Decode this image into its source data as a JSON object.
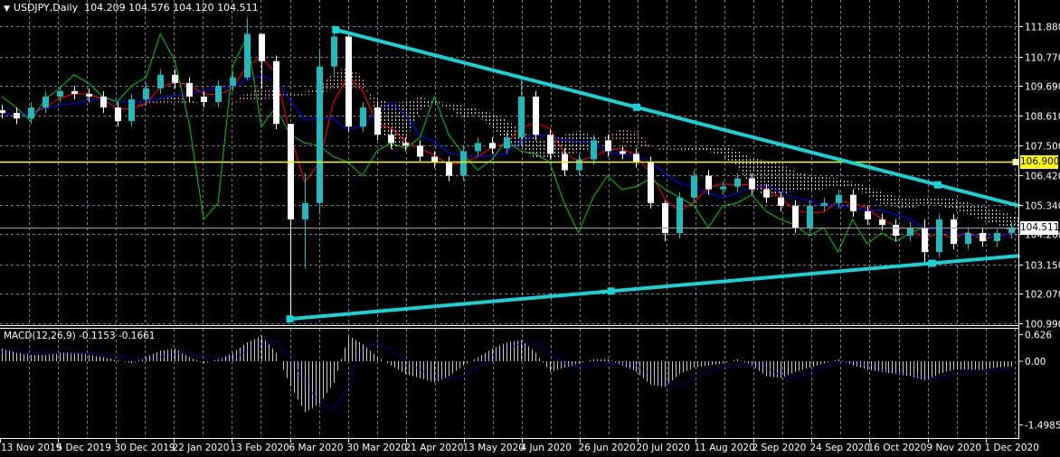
{
  "header": {
    "symbol_timeframe": "USDJPY,Daily",
    "ohlc": "104.209 104.576 104.120 104.511",
    "menu_icon": "triangle-down-icon"
  },
  "macd_header": {
    "label": "MACD(12,26,9)",
    "values": "-0.1153 -0.1661"
  },
  "colors": {
    "background": "#000000",
    "bull_candle": "#26b8b8",
    "bear_candle": "#ffffff",
    "trendline": "#17d3d3",
    "level_line": "#ffff00",
    "tenkan": "#ff0000",
    "kijun": "#0000ff",
    "chikou": "#00c800",
    "cloud_up": "#f4a460",
    "cloud_down": "#e8e8e8",
    "macd_hist": "#c8c8c8",
    "macd_signal": "#0000ff",
    "grid": "#7a8090"
  },
  "chart_data": [
    {
      "type": "candlestick",
      "symbol": "USDJPY",
      "timeframe": "Daily",
      "price_ticks": [
        "111.880",
        "110.770",
        "109.690",
        "108.610",
        "107.500",
        "106.420",
        "105.340",
        "104.260",
        "103.150",
        "102.070",
        "100.990"
      ],
      "ylim": [
        100.99,
        111.88
      ],
      "date_ticks": [
        "13 Nov 2019",
        "5 Dec 2019",
        "30 Dec 2019",
        "22 Jan 2020",
        "13 Feb 2020",
        "6 Mar 2020",
        "30 Mar 2020",
        "21 Apr 2020",
        "13 May 2020",
        "4 Jun 2020",
        "26 Jun 2020",
        "20 Jul 2020",
        "11 Aug 2020",
        "2 Sep 2020",
        "24 Sep 2020",
        "16 Oct 2020",
        "9 Nov 2020",
        "1 Dec 2020"
      ],
      "grid": true,
      "close": [
        108.7,
        108.5,
        108.9,
        109.3,
        109.5,
        109.4,
        109.3,
        108.9,
        108.4,
        109.2,
        109.6,
        110.1,
        109.8,
        109.3,
        109.1,
        109.7,
        110.0,
        111.6,
        110.6,
        108.3,
        104.8,
        105.4,
        110.4,
        111.5,
        108.2,
        108.9,
        107.9,
        107.6,
        107.5,
        107.1,
        106.9,
        106.4,
        107.3,
        107.6,
        107.4,
        107.8,
        109.3,
        107.9,
        107.2,
        106.6,
        107.0,
        107.7,
        107.3,
        107.2,
        106.9,
        105.4,
        104.3,
        105.6,
        106.4,
        105.9,
        106.0,
        106.3,
        105.9,
        105.6,
        105.3,
        104.5,
        105.3,
        105.4,
        105.7,
        105.1,
        104.8,
        104.6,
        104.2,
        104.5,
        103.6,
        104.8,
        103.9,
        104.3,
        104.0,
        104.3,
        104.511
      ],
      "wick_overrides": {
        "17": [
          112.2,
          109.9
        ],
        "18": [
          111.3,
          109.6
        ],
        "20": [
          108.0,
          101.2
        ],
        "21": [
          106.5,
          103.0
        ],
        "22": [
          111.0,
          105.0
        ],
        "23": [
          111.9,
          110.0
        ],
        "36": [
          110.0,
          107.5
        ],
        "46": [
          105.5,
          104.0
        ],
        "64": [
          104.8,
          103.2
        ]
      },
      "horizontal_levels": [
        {
          "price": "106.900",
          "color": "#ffff00"
        },
        {
          "price": "104.511",
          "color": "#a0a0a0"
        }
      ],
      "trendlines": [
        {
          "from_date": "25 Mar 2020",
          "from_price": 111.75,
          "to_date": "14 Dec 2020",
          "to_price": 105.29
        },
        {
          "from_date": "6 Mar 2020",
          "from_price": 101.15,
          "to_date": "14 Dec 2020",
          "to_price": 103.47
        }
      ],
      "indicators": [
        "Ichimoku Kinko Hyo"
      ]
    },
    {
      "type": "bar",
      "name": "MACD(12,26,9)",
      "ticks": [
        "0.626",
        "0.00",
        "-1.4985"
      ],
      "ylim": [
        -1.4985,
        0.626
      ],
      "histogram": [
        0.3,
        0.2,
        0.15,
        0.15,
        0.2,
        0.2,
        0.15,
        0.1,
        0.02,
        -0.05,
        0.1,
        0.25,
        0.3,
        0.1,
        -0.05,
        0.05,
        0.2,
        0.45,
        0.6,
        0.2,
        -0.6,
        -1.2,
        -1.0,
        -0.5,
        0.6,
        0.4,
        0.1,
        -0.1,
        -0.3,
        -0.4,
        -0.5,
        -0.35,
        -0.1,
        0.1,
        0.3,
        0.45,
        0.5,
        0.2,
        -0.25,
        -0.15,
        -0.05,
        0.05,
        0.05,
        -0.1,
        -0.25,
        -0.55,
        -0.6,
        -0.3,
        -0.15,
        -0.1,
        -0.05,
        0.05,
        -0.1,
        -0.35,
        -0.4,
        -0.25,
        -0.15,
        -0.05,
        0.05,
        -0.1,
        -0.2,
        -0.25,
        -0.3,
        -0.35,
        -0.45,
        -0.3,
        -0.2,
        -0.2,
        -0.2,
        -0.15,
        -0.12
      ],
      "signal": [
        0.22,
        0.22,
        0.2,
        0.18,
        0.17,
        0.18,
        0.18,
        0.16,
        0.12,
        0.06,
        0.04,
        0.1,
        0.18,
        0.2,
        0.12,
        0.06,
        0.08,
        0.22,
        0.42,
        0.5,
        0.1,
        -0.5,
        -0.95,
        -1.15,
        -0.6,
        0.3,
        0.45,
        0.25,
        0.0,
        -0.2,
        -0.35,
        -0.42,
        -0.35,
        -0.15,
        0.1,
        0.28,
        0.42,
        0.45,
        0.2,
        -0.05,
        -0.15,
        -0.12,
        -0.05,
        -0.05,
        -0.1,
        -0.3,
        -0.52,
        -0.6,
        -0.4,
        -0.25,
        -0.15,
        -0.08,
        -0.05,
        -0.15,
        -0.32,
        -0.4,
        -0.3,
        -0.15,
        -0.03,
        -0.02,
        -0.1,
        -0.2,
        -0.27,
        -0.3,
        -0.38,
        -0.4,
        -0.32,
        -0.26,
        -0.24,
        -0.2,
        -0.17
      ]
    }
  ]
}
